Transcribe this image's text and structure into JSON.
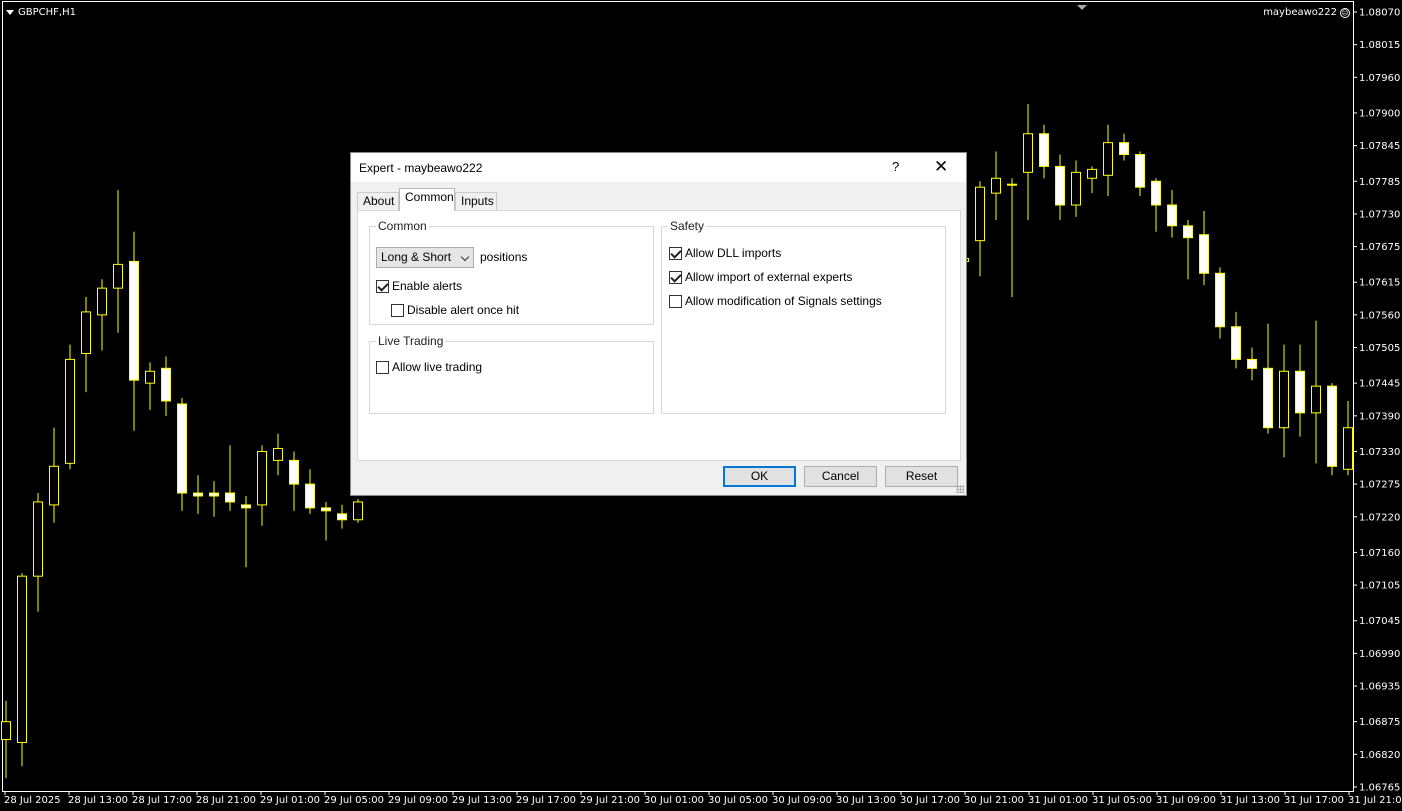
{
  "chart": {
    "symbol": "GBPCHF,H1",
    "expert_name": "maybeawo222",
    "price_ticks": [
      "1.08070",
      "1.08015",
      "1.07960",
      "1.07900",
      "1.07845",
      "1.07785",
      "1.07730",
      "1.07675",
      "1.07615",
      "1.07560",
      "1.07505",
      "1.07445",
      "1.07390",
      "1.07330",
      "1.07275",
      "1.07220",
      "1.07160",
      "1.07105",
      "1.07045",
      "1.06990",
      "1.06935",
      "1.06875",
      "1.06820",
      "1.06765"
    ],
    "time_ticks": [
      "28 Jul 2025",
      "28 Jul 13:00",
      "28 Jul 17:00",
      "28 Jul 21:00",
      "29 Jul 01:00",
      "29 Jul 05:00",
      "29 Jul 09:00",
      "29 Jul 13:00",
      "29 Jul 17:00",
      "29 Jul 21:00",
      "30 Jul 01:00",
      "30 Jul 05:00",
      "30 Jul 09:00",
      "30 Jul 13:00",
      "30 Jul 17:00",
      "30 Jul 21:00",
      "31 Jul 01:00",
      "31 Jul 05:00",
      "31 Jul 09:00",
      "31 Jul 13:00",
      "31 Jul 17:00",
      "31 Jul 21:00"
    ],
    "colors": {
      "background": "#000000",
      "bull_body": "#000000",
      "bear_body": "#ffffff",
      "wick": "#ffff00",
      "text": "#ffffff"
    }
  },
  "chart_data": {
    "type": "candlestick",
    "ylim": [
      1.06765,
      1.0807
    ],
    "bars_left": [
      [
        1.06845,
        1.0691,
        1.0678,
        1.06875
      ],
      [
        1.0684,
        1.07125,
        1.068,
        1.0712
      ],
      [
        1.0712,
        1.0726,
        1.0706,
        1.07245
      ],
      [
        1.0724,
        1.0737,
        1.0721,
        1.07305
      ],
      [
        1.0731,
        1.0751,
        1.073,
        1.07485
      ],
      [
        1.07495,
        1.0759,
        1.0743,
        1.07565
      ],
      [
        1.0756,
        1.0762,
        1.075,
        1.07605
      ],
      [
        1.07605,
        1.0777,
        1.0753,
        1.07645
      ],
      [
        1.0765,
        1.077,
        1.07365,
        1.0745
      ],
      [
        1.07445,
        1.0748,
        1.074,
        1.07465
      ],
      [
        1.0747,
        1.0749,
        1.0739,
        1.07415
      ],
      [
        1.0741,
        1.0742,
        1.0723,
        1.0726
      ],
      [
        1.0726,
        1.0729,
        1.07225,
        1.07255
      ],
      [
        1.0726,
        1.0728,
        1.0722,
        1.07255
      ],
      [
        1.0726,
        1.0734,
        1.0723,
        1.07245
      ],
      [
        1.0724,
        1.07255,
        1.07135,
        1.07235
      ],
      [
        1.0724,
        1.0734,
        1.07205,
        1.0733
      ],
      [
        1.07315,
        1.0736,
        1.0729,
        1.07335
      ],
      [
        1.07315,
        1.0733,
        1.0723,
        1.07275
      ],
      [
        1.07275,
        1.073,
        1.07225,
        1.07235
      ],
      [
        1.07235,
        1.07245,
        1.0718,
        1.0723
      ],
      [
        1.07225,
        1.0724,
        1.072,
        1.07215
      ],
      [
        1.07215,
        1.0725,
        1.0721,
        1.07245
      ]
    ],
    "bars_right": [
      [
        1.0765,
        1.0768,
        1.07605,
        1.07655
      ],
      [
        1.07685,
        1.07785,
        1.07625,
        1.07775
      ],
      [
        1.07765,
        1.07835,
        1.0772,
        1.0779
      ],
      [
        1.0778,
        1.0779,
        1.0759,
        1.0778
      ],
      [
        1.078,
        1.07915,
        1.0772,
        1.07865
      ],
      [
        1.07865,
        1.0788,
        1.0779,
        1.0781
      ],
      [
        1.0781,
        1.0783,
        1.0772,
        1.07745
      ],
      [
        1.07745,
        1.0782,
        1.07725,
        1.078
      ],
      [
        1.0779,
        1.0781,
        1.07765,
        1.07805
      ],
      [
        1.07795,
        1.0788,
        1.0776,
        1.0785
      ],
      [
        1.0785,
        1.07865,
        1.0782,
        1.0783
      ],
      [
        1.0783,
        1.07835,
        1.0776,
        1.07775
      ],
      [
        1.07785,
        1.0779,
        1.077,
        1.07745
      ],
      [
        1.07745,
        1.0777,
        1.0769,
        1.0771
      ],
      [
        1.0771,
        1.0772,
        1.0762,
        1.0769
      ],
      [
        1.07695,
        1.07735,
        1.0761,
        1.0763
      ],
      [
        1.0763,
        1.0764,
        1.0752,
        1.0754
      ],
      [
        1.0754,
        1.07565,
        1.0747,
        1.07485
      ],
      [
        1.07485,
        1.07505,
        1.0745,
        1.0747
      ],
      [
        1.0747,
        1.07545,
        1.0736,
        1.0737
      ],
      [
        1.0737,
        1.0751,
        1.0732,
        1.07465
      ],
      [
        1.07465,
        1.0751,
        1.07355,
        1.07395
      ],
      [
        1.07395,
        1.0755,
        1.0731,
        1.0744
      ],
      [
        1.0744,
        1.07445,
        1.0729,
        1.07305
      ],
      [
        1.073,
        1.07415,
        1.0729,
        1.0737
      ]
    ]
  },
  "dialog": {
    "title": "Expert - maybeawo222",
    "help": "?",
    "close": "✕",
    "tabs": [
      "About",
      "Common",
      "Inputs"
    ],
    "common": {
      "legend": "Common",
      "positions_select": "Long & Short",
      "positions_label": "positions",
      "enable_alerts": "Enable alerts",
      "disable_alert_once_hit": "Disable alert once hit"
    },
    "live": {
      "legend": "Live Trading",
      "allow_live_trading": "Allow live trading"
    },
    "safety": {
      "legend": "Safety",
      "allow_dll": "Allow DLL imports",
      "allow_external": "Allow import of external experts",
      "allow_signals": "Allow modification of Signals settings"
    },
    "buttons": {
      "ok": "OK",
      "cancel": "Cancel",
      "reset": "Reset"
    }
  }
}
